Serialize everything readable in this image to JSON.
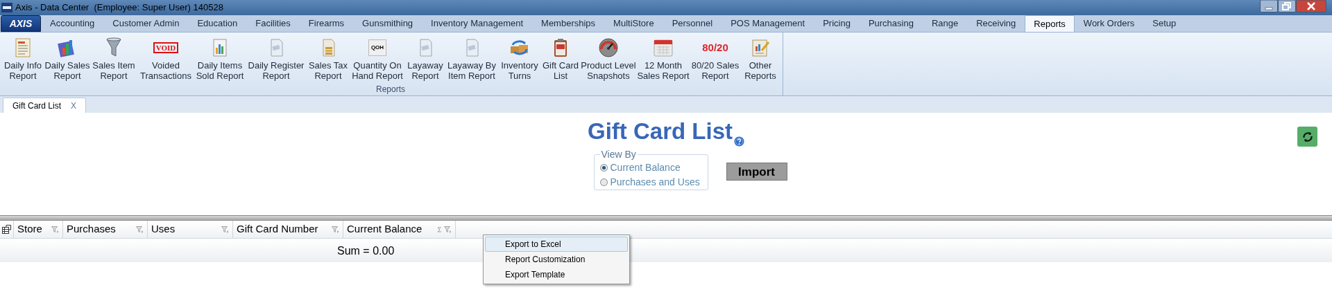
{
  "window": {
    "title": "Axis - Data Center  (Employee: Super User) 140528",
    "app_logo": "AXIS"
  },
  "menu_tabs": [
    {
      "label": "Accounting",
      "selected": false
    },
    {
      "label": "Customer Admin",
      "selected": false
    },
    {
      "label": "Education",
      "selected": false
    },
    {
      "label": "Facilities",
      "selected": false
    },
    {
      "label": "Firearms",
      "selected": false
    },
    {
      "label": "Gunsmithing",
      "selected": false
    },
    {
      "label": "Inventory Management",
      "selected": false
    },
    {
      "label": "Memberships",
      "selected": false
    },
    {
      "label": "MultiStore",
      "selected": false
    },
    {
      "label": "Personnel",
      "selected": false
    },
    {
      "label": "POS Management",
      "selected": false
    },
    {
      "label": "Pricing",
      "selected": false
    },
    {
      "label": "Purchasing",
      "selected": false
    },
    {
      "label": "Range",
      "selected": false
    },
    {
      "label": "Receiving",
      "selected": false
    },
    {
      "label": "Reports",
      "selected": true
    },
    {
      "label": "Work Orders",
      "selected": false
    },
    {
      "label": "Setup",
      "selected": false
    }
  ],
  "ribbon": {
    "group_label": "Reports",
    "items": [
      {
        "label": "Daily Info Report",
        "kind": "document"
      },
      {
        "label": "Daily Sales Report",
        "kind": "chart"
      },
      {
        "label": "Sales Item Report",
        "kind": "funnel"
      },
      {
        "label": "Voided Transactions",
        "kind": "stamp",
        "icon_text": "VOID"
      },
      {
        "label": "Daily Items Sold Report",
        "kind": "bars"
      },
      {
        "label": "Daily Register Report",
        "kind": "page"
      },
      {
        "label": "Sales Tax Report",
        "kind": "coins"
      },
      {
        "label": "Quantity On Hand Report",
        "kind": "label",
        "icon_text": "QOH"
      },
      {
        "label": "Layaway Report",
        "kind": "page"
      },
      {
        "label": "Layaway By Item Report",
        "kind": "page"
      },
      {
        "label": "Inventory Turns",
        "kind": "boxes"
      },
      {
        "label": "Gift Card List",
        "kind": "clipboard"
      },
      {
        "label": "Product Level Snapshots",
        "kind": "gauge"
      },
      {
        "label": "12 Month Sales Report",
        "kind": "calendar"
      },
      {
        "label": "80/20 Sales Report",
        "kind": "ratio",
        "icon_text": "80/20"
      },
      {
        "label": "Other Reports",
        "kind": "notes"
      }
    ]
  },
  "document_tabs": [
    {
      "label": "Gift Card List",
      "close": "X",
      "selected": true
    }
  ],
  "heading": "Gift Card List",
  "view_by": {
    "legend": "View By",
    "options": [
      {
        "label": "Current Balance",
        "selected": true
      },
      {
        "label": "Purchases and Uses",
        "selected": false
      }
    ]
  },
  "import_button": "Import",
  "grid": {
    "columns": [
      {
        "label": "Store",
        "sum": false
      },
      {
        "label": "Purchases",
        "sum": false
      },
      {
        "label": "Uses",
        "sum": false
      },
      {
        "label": "Gift Card Number",
        "sum": false
      },
      {
        "label": "Current Balance",
        "sum": true
      }
    ],
    "summary": "Sum = 0.00"
  },
  "context_menu": [
    {
      "label": "Export to Excel",
      "selected": true
    },
    {
      "label": "Report Customization",
      "selected": false
    },
    {
      "label": "Export Template",
      "selected": false
    }
  ]
}
